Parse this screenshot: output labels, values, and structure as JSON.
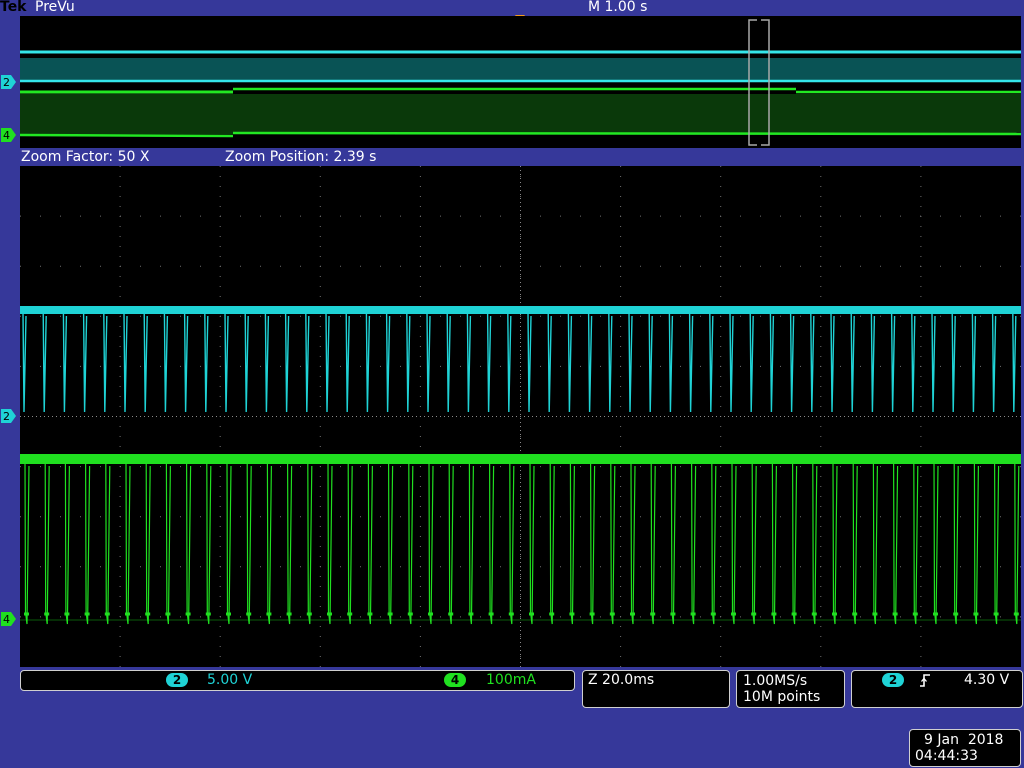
{
  "header": {
    "brand": "Tek",
    "mode": "PreVu",
    "timebase": "M 1.00 s"
  },
  "zoom": {
    "factor_text": "Zoom Factor: 50 X",
    "position_text": "Zoom Position: 2.39 s"
  },
  "channels": [
    {
      "id": "2",
      "scale": "5.00 V",
      "color": "#1fd3d6"
    },
    {
      "id": "4",
      "scale": "100mA",
      "color": "#20e020"
    }
  ],
  "horizontal": {
    "zoom_scale": "Z 20.0ms",
    "sample_rate": "1.00MS/s",
    "record_length": "10M points"
  },
  "trigger": {
    "source": "2",
    "slope_icon": "rising-edge-icon",
    "level": "4.30 V",
    "marker_color": "#f39a1f"
  },
  "datetime": {
    "date": "9 Jan  2018",
    "time": "04:44:33"
  },
  "colors": {
    "background": "#36389a",
    "graticule": "#000000",
    "grid_dots": "#6f6f6f"
  }
}
